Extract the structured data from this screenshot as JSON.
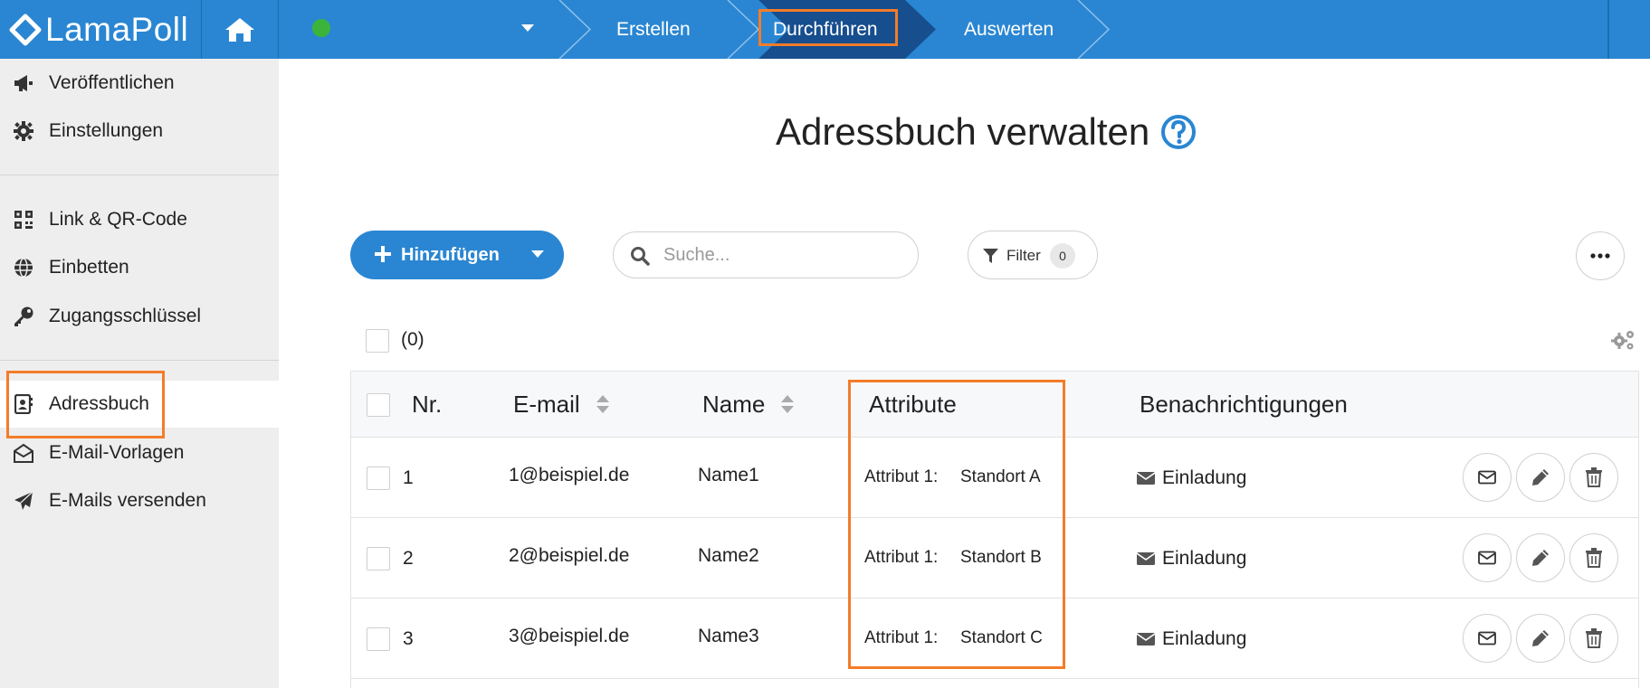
{
  "app": {
    "logo_text": "LamaPoll"
  },
  "topnav": {
    "steps": [
      {
        "label": "Erstellen"
      },
      {
        "label": "Durchführen"
      },
      {
        "label": "Auswerten"
      }
    ],
    "active_step": "Durchführen"
  },
  "sidebar": {
    "items": [
      {
        "label": "Veröffentlichen",
        "icon": "megaphone-icon"
      },
      {
        "label": "Einstellungen",
        "icon": "gear-icon"
      },
      {
        "label": "Link & QR-Code",
        "icon": "qr-code-icon"
      },
      {
        "label": "Einbetten",
        "icon": "globe-icon"
      },
      {
        "label": "Zugangsschlüssel",
        "icon": "key-icon"
      },
      {
        "label": "Adressbuch",
        "icon": "address-book-icon"
      },
      {
        "label": "E-Mail-Vorlagen",
        "icon": "envelope-open-icon"
      },
      {
        "label": "E-Mails versenden",
        "icon": "paper-plane-icon"
      }
    ],
    "active": "Adressbuch"
  },
  "main": {
    "title": "Adressbuch verwalten",
    "toolbar": {
      "add_label": "Hinzufügen",
      "search_placeholder": "Suche...",
      "filter_label": "Filter",
      "filter_count": "0"
    },
    "selection_count": "(0)",
    "table": {
      "headers": {
        "nr": "Nr.",
        "email": "E-mail",
        "name": "Name",
        "attribute": "Attribute",
        "notifications": "Benachrichtigungen"
      },
      "rows": [
        {
          "nr": "1",
          "email": "1@beispiel.de",
          "name": "Name1",
          "attr_key": "Attribut 1:",
          "attr_value": "Standort A",
          "notification": "Einladung"
        },
        {
          "nr": "2",
          "email": "2@beispiel.de",
          "name": "Name2",
          "attr_key": "Attribut 1:",
          "attr_value": "Standort B",
          "notification": "Einladung"
        },
        {
          "nr": "3",
          "email": "3@beispiel.de",
          "name": "Name3",
          "attr_key": "Attribut 1:",
          "attr_value": "Standort C",
          "notification": "Einladung"
        }
      ]
    }
  },
  "colors": {
    "primary": "#2a86d2",
    "active_step": "#164e8e",
    "highlight_frame": "#f47c2a",
    "status_online": "#3cb43c",
    "sidebar_bg": "#eeeeee"
  }
}
